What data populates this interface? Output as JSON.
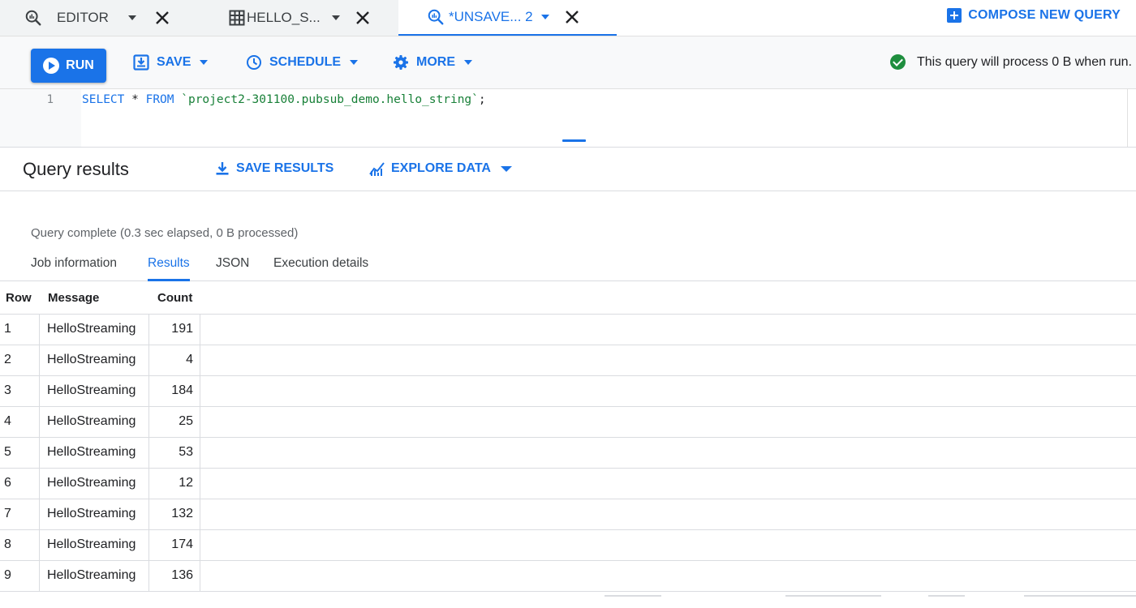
{
  "tabs": [
    {
      "label": "EDITOR",
      "icon": "query-icon",
      "active": false,
      "closable": true
    },
    {
      "label": "HELLO_S...",
      "icon": "table-icon",
      "active": false,
      "closable": true
    },
    {
      "label": "*UNSAVE... 2",
      "icon": "query-icon",
      "active": true,
      "closable": true
    }
  ],
  "compose_label": "COMPOSE NEW QUERY",
  "toolbar": {
    "run_label": "RUN",
    "save_label": "SAVE",
    "schedule_label": "SCHEDULE",
    "more_label": "MORE",
    "status_text": "This query will process 0 B when run."
  },
  "editor": {
    "line_number": "1",
    "kw_select": "SELECT",
    "star": " * ",
    "kw_from": "FROM",
    "table_ref": " `project2-301100.pubsub_demo.hello_string`",
    "semicolon": ";"
  },
  "results": {
    "title": "Query results",
    "save_results_label": "SAVE RESULTS",
    "explore_data_label": "EXPLORE DATA",
    "status": "Query complete (0.3 sec elapsed, 0 B processed)",
    "tabs": [
      "Job information",
      "Results",
      "JSON",
      "Execution details"
    ],
    "active_tab": "Results",
    "columns": [
      "Row",
      "Message",
      "Count"
    ],
    "rows": [
      [
        "1",
        "HelloStreaming",
        "191"
      ],
      [
        "2",
        "HelloStreaming",
        "4"
      ],
      [
        "3",
        "HelloStreaming",
        "184"
      ],
      [
        "4",
        "HelloStreaming",
        "25"
      ],
      [
        "5",
        "HelloStreaming",
        "53"
      ],
      [
        "6",
        "HelloStreaming",
        "12"
      ],
      [
        "7",
        "HelloStreaming",
        "132"
      ],
      [
        "8",
        "HelloStreaming",
        "174"
      ],
      [
        "9",
        "HelloStreaming",
        "136"
      ]
    ]
  },
  "colors": {
    "accent": "#1a73e8",
    "success": "#1e8e3e",
    "string_literal": "#188038"
  }
}
